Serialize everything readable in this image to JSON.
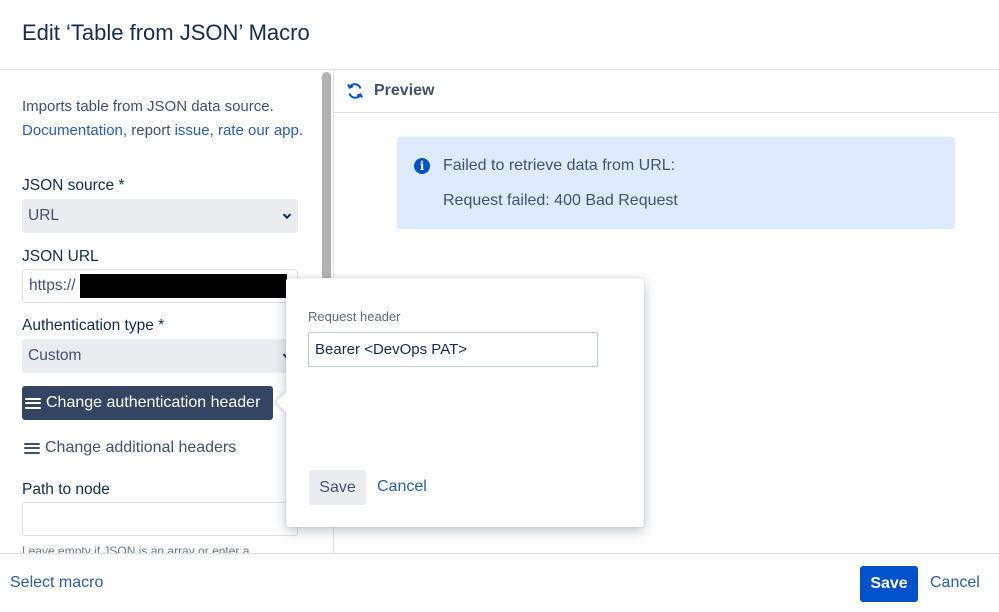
{
  "dialog": {
    "title": "Edit ‘Table from JSON’ Macro"
  },
  "intro": {
    "text": "Imports table from JSON data source.",
    "documentation_link": "Documentation",
    "comma_report": ", report ",
    "issue_link": "issue",
    "comma": ", ",
    "rate_link": "rate our app",
    "period": "."
  },
  "form": {
    "json_source_label": "JSON source *",
    "json_source_value": "URL",
    "json_url_label": "JSON URL",
    "json_url_value": "https://",
    "auth_type_label": "Authentication type *",
    "auth_type_value": "Custom",
    "change_auth_header_label": "Change authentication header",
    "change_additional_headers_label": "Change additional headers",
    "path_to_node_label": "Path to node",
    "path_hint": "Leave empty if JSON is an array or enter a"
  },
  "preview": {
    "title": "Preview",
    "error_line1": "Failed to retrieve data from URL:",
    "error_line2": "Request failed: 400 Bad Request"
  },
  "popup": {
    "label": "Request header",
    "input_value": "Bearer <DevOps PAT>",
    "save_label": "Save",
    "cancel_label": "Cancel"
  },
  "footer": {
    "select_macro_label": "Select macro",
    "save_label": "Save",
    "cancel_label": "Cancel"
  },
  "colors": {
    "primary": "#0052cc",
    "link": "#2c5fa8",
    "dark_button": "#344563",
    "info_bg": "#deebff",
    "select_bg": "#ebecf0"
  }
}
